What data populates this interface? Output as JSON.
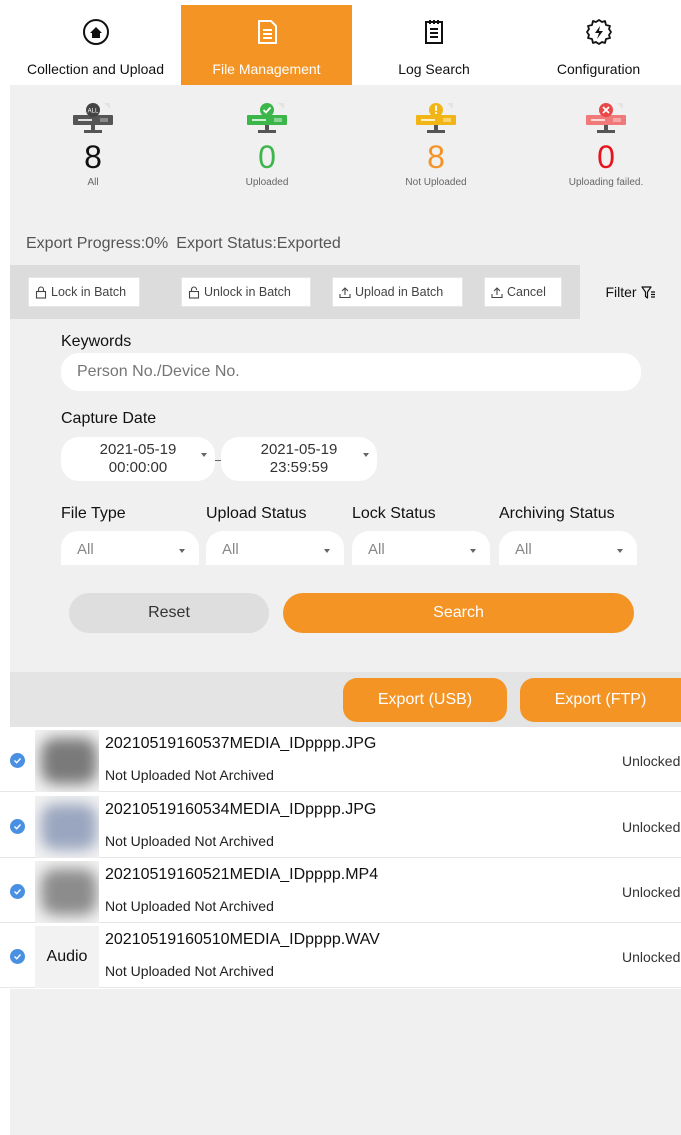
{
  "nav": {
    "tabs": [
      {
        "label": "Collection and Upload",
        "icon": "home-icon"
      },
      {
        "label": "File Management",
        "icon": "document-icon",
        "active": true
      },
      {
        "label": "Log Search",
        "icon": "log-list-icon"
      },
      {
        "label": "Configuration",
        "icon": "gear-icon"
      }
    ]
  },
  "stats": {
    "items": [
      {
        "count": "8",
        "label": "All",
        "badge_text": "ALL",
        "color": "#111111",
        "screen_color": "#555555"
      },
      {
        "count": "0",
        "label": "Uploaded",
        "color": "#3cb54a",
        "screen_color": "#3cb54a"
      },
      {
        "count": "8",
        "label": "Not Uploaded",
        "color": "#f39425",
        "screen_color": "#f2b518"
      },
      {
        "count": "0",
        "label": "Uploading failed.",
        "color": "#e8141c",
        "screen_color": "#f07a7a"
      }
    ]
  },
  "export": {
    "progress": "Export Progress:0%",
    "status": "Export Status:Exported"
  },
  "batch": {
    "lock": "Lock in Batch",
    "unlock": "Unlock in Batch",
    "upload": "Upload in Batch",
    "cancel": "Cancel",
    "filter": "Filter"
  },
  "form": {
    "keywords_label": "Keywords",
    "keywords_placeholder": "Person No./Device No.",
    "capture_date_label": "Capture Date",
    "start_date": "2021-05-19",
    "start_time": "00:00:00",
    "end_date": "2021-05-19",
    "end_time": "23:59:59",
    "selects": [
      {
        "label": "File Type",
        "value": "All"
      },
      {
        "label": "Upload Status",
        "value": "All"
      },
      {
        "label": "Lock Status",
        "value": "All"
      },
      {
        "label": "Archiving Status",
        "value": "All"
      }
    ],
    "reset": "Reset",
    "search": "Search"
  },
  "export_buttons": {
    "usb": "Export (USB)",
    "ftp": "Export (FTP)"
  },
  "files": [
    {
      "name": "20210519160537MEDIA_IDpppp.JPG",
      "status": "Not Uploaded Not Archived",
      "lock": "Unlocked",
      "thumb": "image",
      "thumb_color": "#7a7a7a"
    },
    {
      "name": "20210519160534MEDIA_IDpppp.JPG",
      "status": "Not Uploaded Not Archived",
      "lock": "Unlocked",
      "thumb": "image",
      "thumb_color": "#9aa6bf"
    },
    {
      "name": "20210519160521MEDIA_IDpppp.MP4",
      "status": "Not Uploaded Not Archived",
      "lock": "Unlocked",
      "thumb": "image",
      "thumb_color": "#8c8c8c"
    },
    {
      "name": "20210519160510MEDIA_IDpppp.WAV",
      "status": "Not Uploaded Not Archived",
      "lock": "Unlocked",
      "thumb": "audio",
      "thumb_text": "Audio"
    }
  ],
  "colors": {
    "accent": "#f39425",
    "check": "#4a90e2"
  }
}
